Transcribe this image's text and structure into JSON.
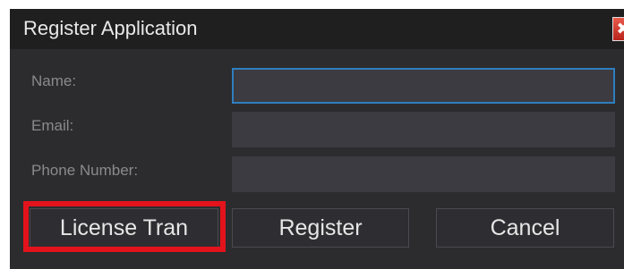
{
  "window": {
    "title": "Register Application",
    "close_glyph": "✖"
  },
  "form": {
    "name_label": "Name:",
    "email_label": "Email:",
    "phone_label": "Phone Number:",
    "name_value": "",
    "email_value": "",
    "phone_value": ""
  },
  "buttons": {
    "license_transfer": "License Tran",
    "register": "Register",
    "cancel": "Cancel"
  },
  "colors": {
    "dialog_bg": "#2c2c2f",
    "titlebar_bg": "#1f1f1f",
    "input_bg": "#3b3b41",
    "focus_border": "#2f7fbf",
    "highlight": "#e3131c",
    "close_button": "#c9302c"
  }
}
